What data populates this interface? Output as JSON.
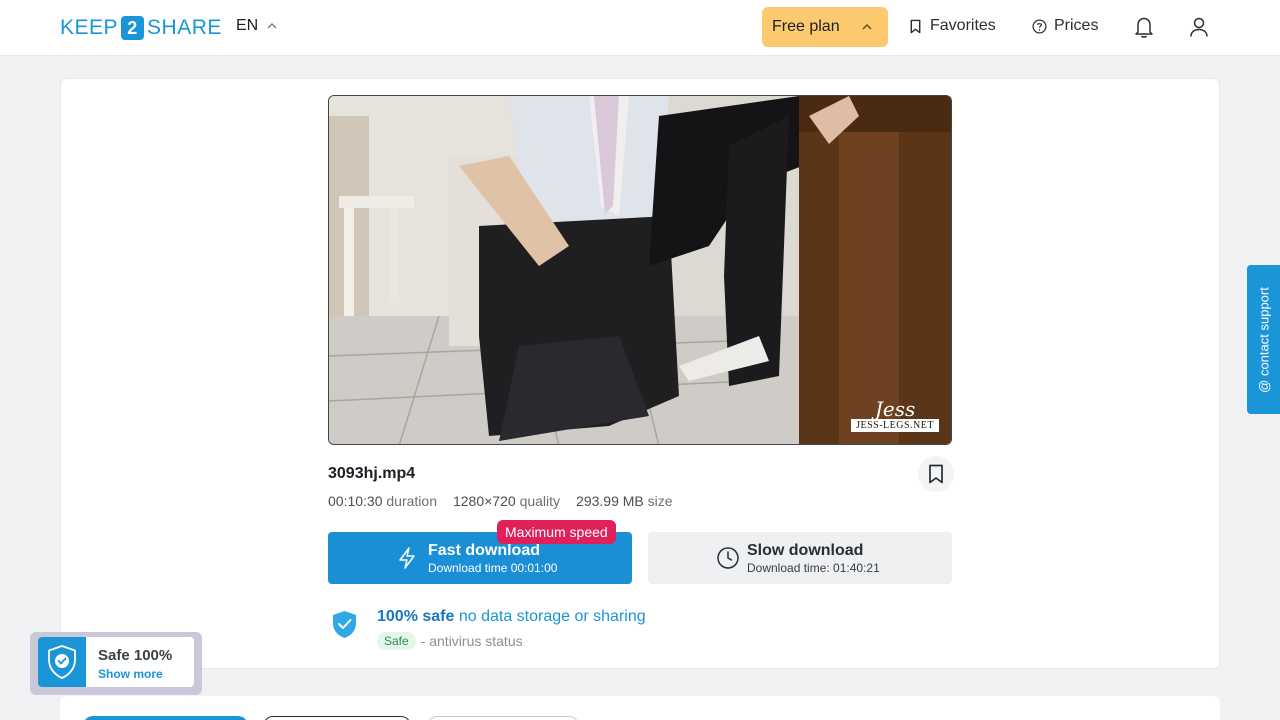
{
  "header": {
    "logo": {
      "left": "KEEP",
      "mid": "2",
      "right": "SHARE"
    },
    "language": "EN",
    "plan_label": "Free plan",
    "favorites_label": "Favorites",
    "prices_label": "Prices"
  },
  "file": {
    "name": "3093hj.mp4",
    "duration_value": "00:10:30",
    "duration_label": "duration",
    "quality_value": "1280×720",
    "quality_label": "quality",
    "size_value": "293.99 MB",
    "size_label": "size",
    "watermark_signature": "Jess",
    "watermark_url": "JESS-LEGS.NET"
  },
  "download": {
    "badge": "Maximum speed",
    "fast_title": "Fast download",
    "fast_sub": "Download time 00:01:00",
    "slow_title": "Slow download",
    "slow_sub": "Download time: 01:40:21"
  },
  "safety": {
    "title_bold": "100% safe",
    "title_rest": "no data storage or sharing",
    "tag": "Safe",
    "status": "- antivirus status"
  },
  "support_label": "@ contact support",
  "widget": {
    "title": "Safe 100%",
    "link": "Show more"
  },
  "colors": {
    "accent": "#1a95d8",
    "plan": "#fcc96f",
    "badge": "#e0205a"
  }
}
